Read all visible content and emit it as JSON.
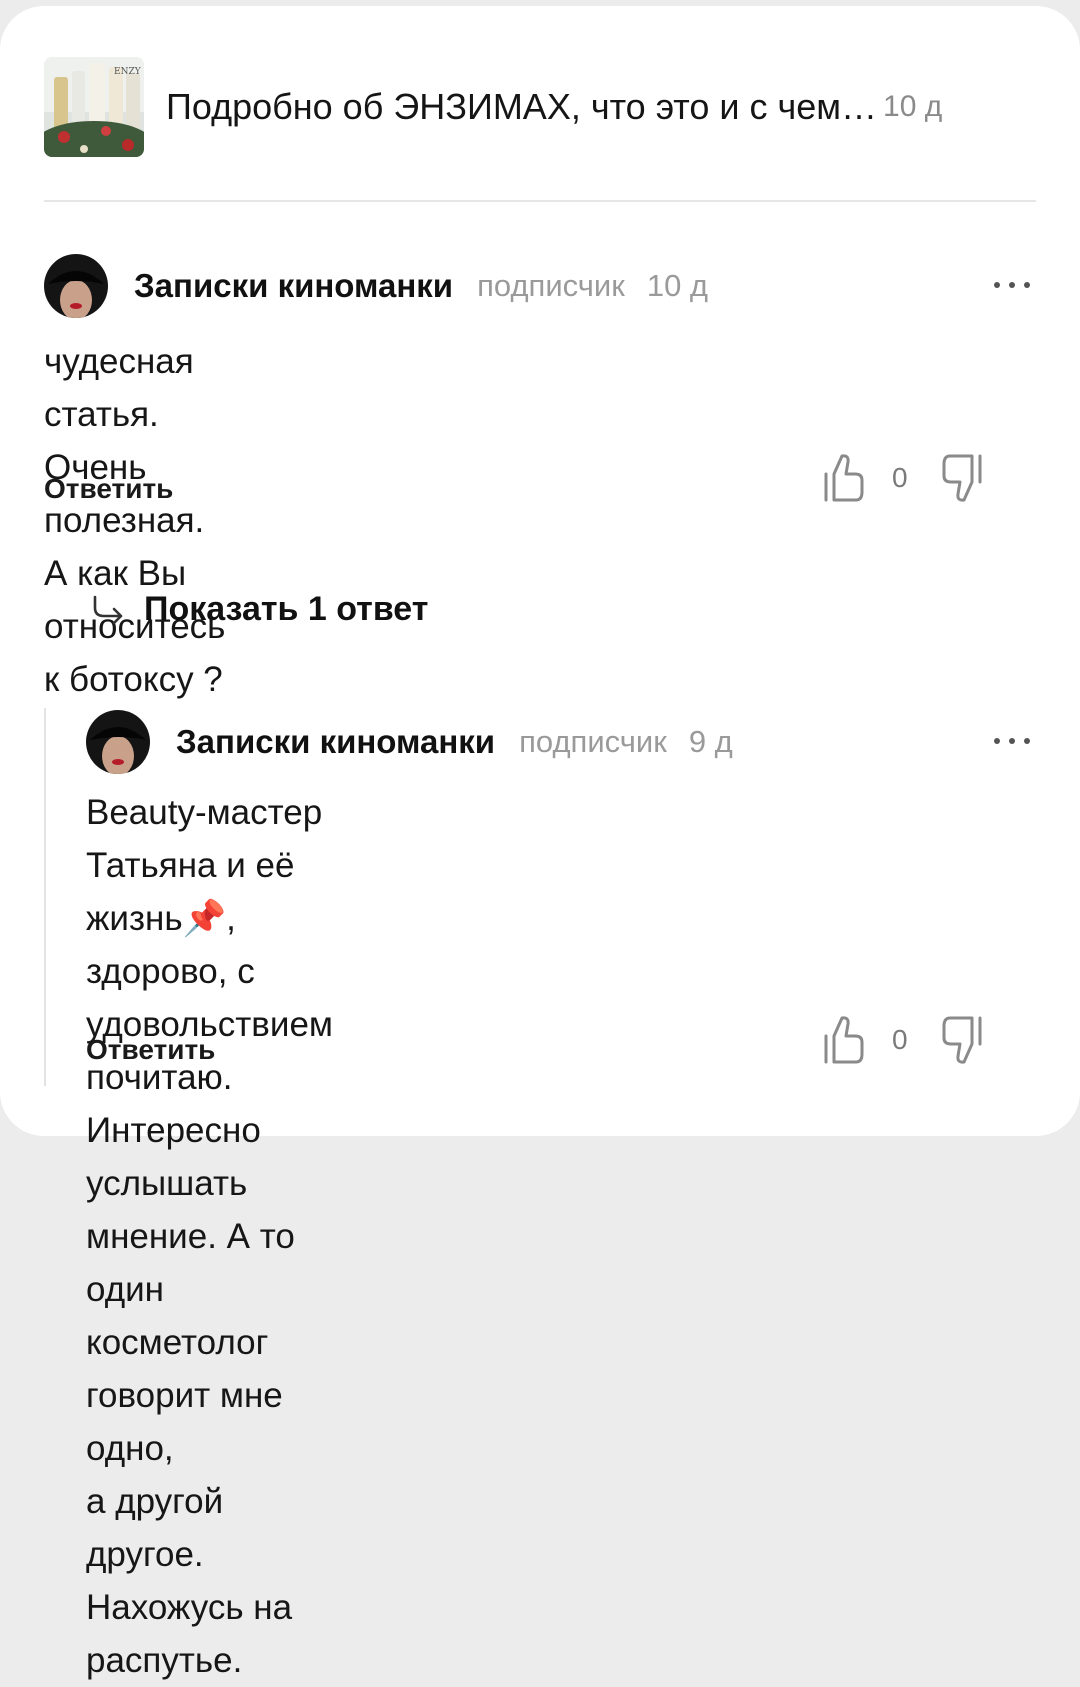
{
  "article": {
    "title": "Подробно об ЭНЗИМАХ, что это и с чем…",
    "age": "10 д",
    "thumb_text": "ENZY"
  },
  "comments": [
    {
      "author": "Записки киноманки",
      "role": "подписчик",
      "age": "10 д",
      "text_lines": [
        "чудесная статья. Очень полезная. А как Вы",
        "относитесь к ботоксу ?"
      ],
      "reply_label": "Ответить",
      "likes": "0"
    },
    {
      "author": "Записки киноманки",
      "role": "подписчик",
      "age": "9 д",
      "text_lines": [
        "Beauty-мастер Татьяна и её жизнь📌, здорово, с",
        "удовольствием почитаю. Интересно услышать",
        "мнение. А то один косметолог говорит мне одно,",
        "а другой другое. Нахожусь на распутье."
      ],
      "reply_label": "Ответить",
      "likes": "0"
    }
  ],
  "show_replies_label": "Показать 1 ответ",
  "icons": [
    "thumb-up-icon",
    "thumb-down-icon",
    "more-dots-icon",
    "reply-arrow-icon"
  ]
}
